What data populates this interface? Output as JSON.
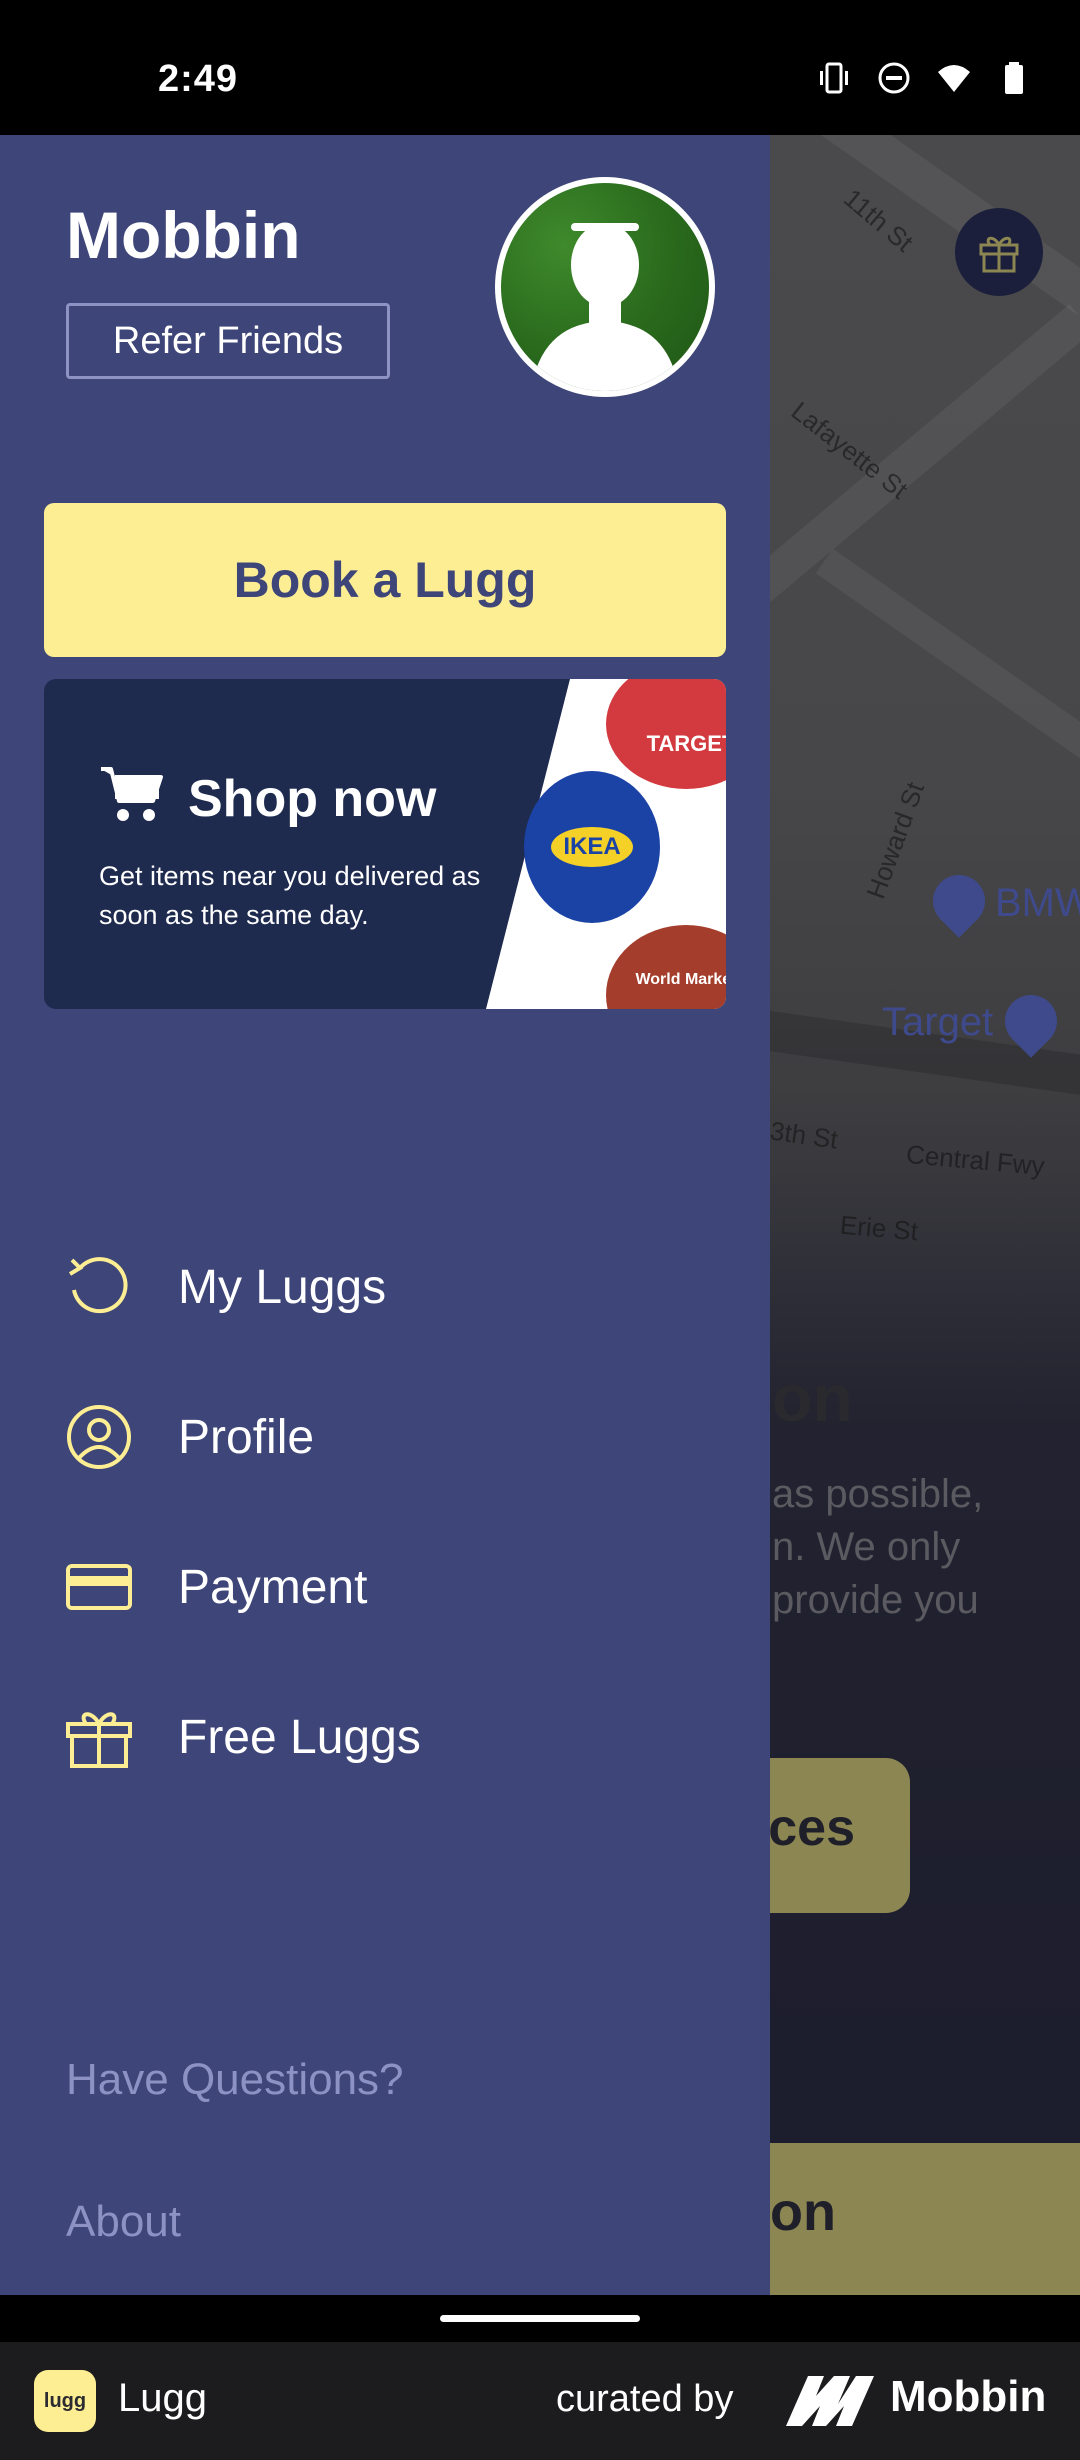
{
  "status_bar": {
    "time": "2:49",
    "icons": [
      "vibrate-icon",
      "do-not-disturb-icon",
      "wifi-icon",
      "battery-icon"
    ]
  },
  "drawer": {
    "user_name": "Mobbin",
    "refer_label": "Refer Friends",
    "book_label": "Book a Lugg",
    "shop": {
      "title": "Shop now",
      "description": "Get items near you delivered as soon as the same day.",
      "brands": [
        "TARGET",
        "IKEA",
        "World Market"
      ]
    },
    "menu": [
      {
        "label": "My Luggs",
        "icon": "history-icon"
      },
      {
        "label": "Profile",
        "icon": "user-circle-icon"
      },
      {
        "label": "Payment",
        "icon": "credit-card-icon"
      },
      {
        "label": "Free Luggs",
        "icon": "gift-icon"
      }
    ],
    "footer": {
      "questions": "Have Questions?",
      "about": "About"
    }
  },
  "background": {
    "map_labels": [
      "11th St",
      "Lafayette St",
      "Howard St",
      "3th St",
      "Central Fwy",
      "Erie St"
    ],
    "pois": [
      "BMW",
      "Target"
    ],
    "heading_fragment": "on",
    "text_lines": [
      "as possible,",
      "n. We only",
      "provide you"
    ],
    "button_fragment": "ces",
    "bottom_fragment": "on"
  },
  "brand_bar": {
    "app_name": "Lugg",
    "app_logo": "lugg",
    "curated_by": "curated by",
    "mobbin": "Mobbin"
  },
  "colors": {
    "drawer_bg": "#3e4578",
    "accent_yellow": "#fdee94",
    "muted_text": "#8c92c4"
  }
}
